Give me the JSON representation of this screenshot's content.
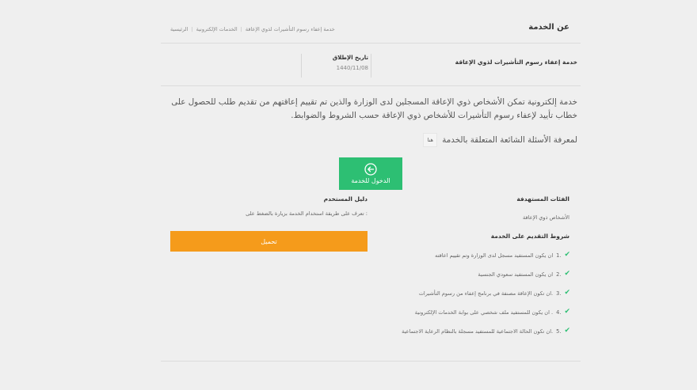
{
  "header": {
    "title": "عن الخدمة",
    "breadcrumb": [
      "الرئيسية",
      "الخدمات الإلكترونية",
      "خدمة إعفاء رسوم التأشيرات لذوي الإعاقة"
    ]
  },
  "service": {
    "name": "خدمة إعفاء رسوم التأشيرات لذوي الإعاقة",
    "date_label": "تاريخ الإطلاق",
    "date_value": "1440/11/08"
  },
  "description": "خدمة إلكترونية تمكن الأشخاص ذوي الإعاقة المسجلين لدى الوزارة والذين تم تقييم إعاقتهم من تقديم طلب للحصول على خطاب تأييد لإعفاء رسوم التأشيرات للأشخاص ذوي الإعاقة حسب الشروط والضوابط.",
  "faq": {
    "text": "لمعرفة الأسئلة الشائعة المتعلقة بالخدمة",
    "button_label": "هنا"
  },
  "enter_button": {
    "label": "الدخول للخدمة",
    "icon": "arrow-left-circle-icon"
  },
  "target": {
    "title": "الفئات المستهدفة",
    "value": "الأشخاص ذوي الإعاقة"
  },
  "guide": {
    "title": "دليل المستخدم",
    "text": "تعرف على طريقة استخدام الخدمة بزيارة بالضغط على :",
    "download_label": "تحميل"
  },
  "conditions": {
    "title": "شروط التقديم على الخدمة",
    "items": [
      {
        "num": "1.",
        "text": "ان يكون المستفيد مسجل لدى الوزارة وتم تقييم اعاقته"
      },
      {
        "num": "2.",
        "text": "ان يكون المستفيد سعودي الجنسية"
      },
      {
        "num": "3.",
        "text": "ان تكون الإعاقة مصنفة في برنامج إعفاء من رسوم التأشيرات."
      },
      {
        "num": "4.",
        "text": "ان يكون للمستفيد ملف شخصي على بوابة الخدمات الإلكترونية ."
      },
      {
        "num": "5.",
        "text": "ان تكون الحالة الاجتماعية للمستفيد مسجلة بالنظام الرعاية الاجتماعية."
      }
    ]
  },
  "colors": {
    "green": "#2dbf73",
    "orange": "#f59b1b"
  }
}
